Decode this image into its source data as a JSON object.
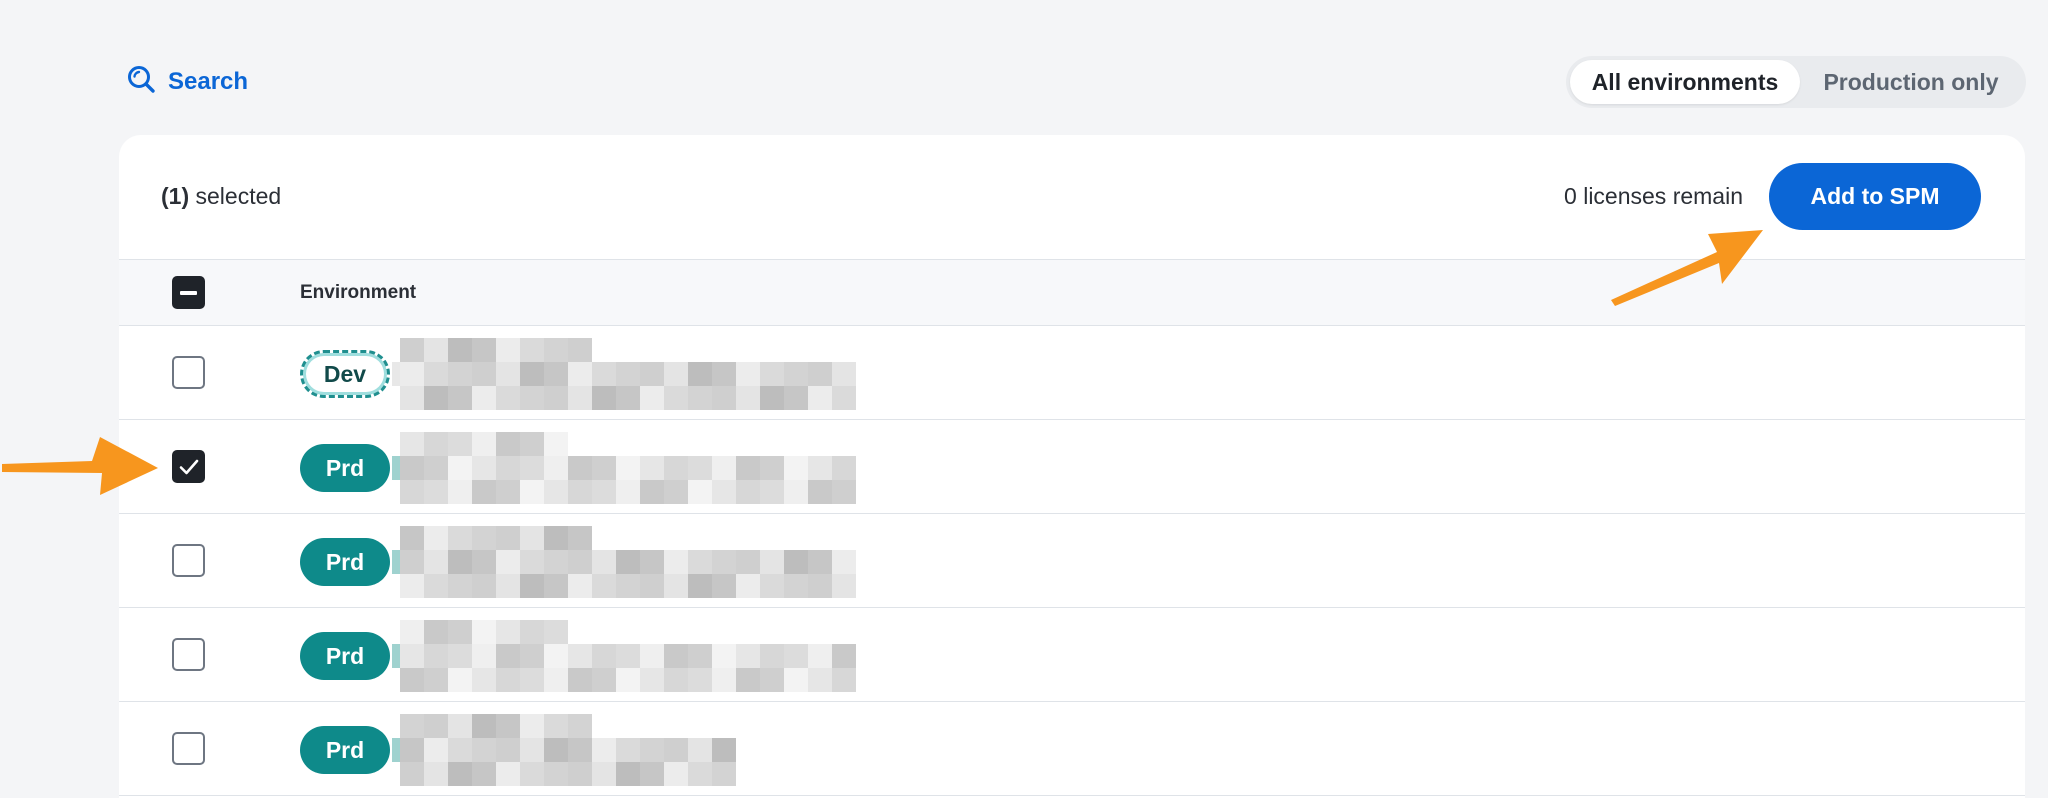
{
  "toolbar": {
    "search_label": "Search",
    "search_icon": "search-icon"
  },
  "environment_filter": {
    "options": [
      "All environments",
      "Production only"
    ],
    "selected": "All environments"
  },
  "card": {
    "selected_count": "(1)",
    "selected_suffix": " selected",
    "licenses_text": "0 licenses remain",
    "add_button_label": "Add to SPM"
  },
  "table": {
    "header_checkbox_state": "indeterminate",
    "columns": [
      "Environment"
    ],
    "rows": [
      {
        "env": "Dev",
        "checked": false
      },
      {
        "env": "Prd",
        "checked": true
      },
      {
        "env": "Prd",
        "checked": false
      },
      {
        "env": "Prd",
        "checked": false
      },
      {
        "env": "Prd",
        "checked": false
      }
    ]
  },
  "colors": {
    "accent": "#0b66d6",
    "prd_badge": "#0e8a8a",
    "annotation_arrow": "#f7961e"
  }
}
